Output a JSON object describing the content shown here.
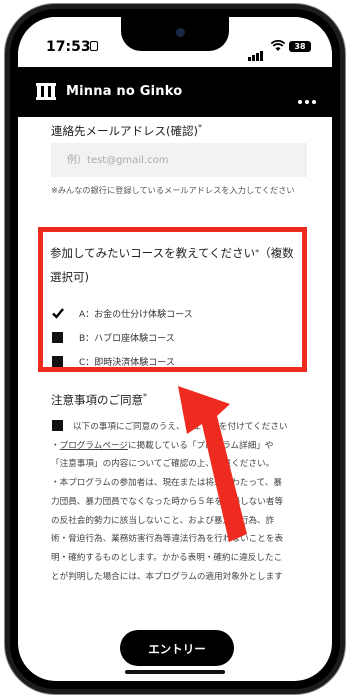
{
  "status": {
    "time": "17:53",
    "battery": "38"
  },
  "header": {
    "brand": "Minna no Ginko"
  },
  "form": {
    "email_confirm_label": "連絡先メールアドレス(確認)",
    "required_mark": "*",
    "email_placeholder": "例）test@gmail.com",
    "email_note": "※みんなの銀行に登録しているメールアドレスを入力してください",
    "course_question": "参加してみたいコースを教えてください",
    "course_question_suffix": "（複数選択可)",
    "options": [
      {
        "label": "A：お金の仕分け体験コース",
        "checked": true
      },
      {
        "label": "B：ハブロ座体験コース",
        "checked": false
      },
      {
        "label": "C：即時決済体験コース",
        "checked": false
      }
    ],
    "consent_title": "注意事項のご同意",
    "consent_lines": [
      "以下の事項にご同意のうえ、チェックを付けてください",
      "・プログラムページに掲載しているプログラム詳細」や",
      "「注意事項」の内容についてご確認の上、同意ください。",
      "・本プログラムの参加者は、現在または将来にわたって、暴",
      "力団員、暴力団員でなくなった時から５年を経過しない者等",
      "の反社会的勢力に該当しないこと、および暴力的行為、詐",
      "術・脅迫行為、業務妨害行為等違法行為を行わないことを表",
      "明・確約するものとします。かかる表明・確約に違反したこ",
      "とが判明した場合には、本プログラムの適用対象外とします"
    ],
    "link_text": "プログラムページ",
    "entry_button": "エントリー"
  },
  "colors": {
    "highlight": "#ef2a1f",
    "header_bg": "#000000"
  },
  "icons": [
    "logo-mark-icon",
    "menu-dots-icon",
    "check-icon",
    "arrow-icon"
  ]
}
